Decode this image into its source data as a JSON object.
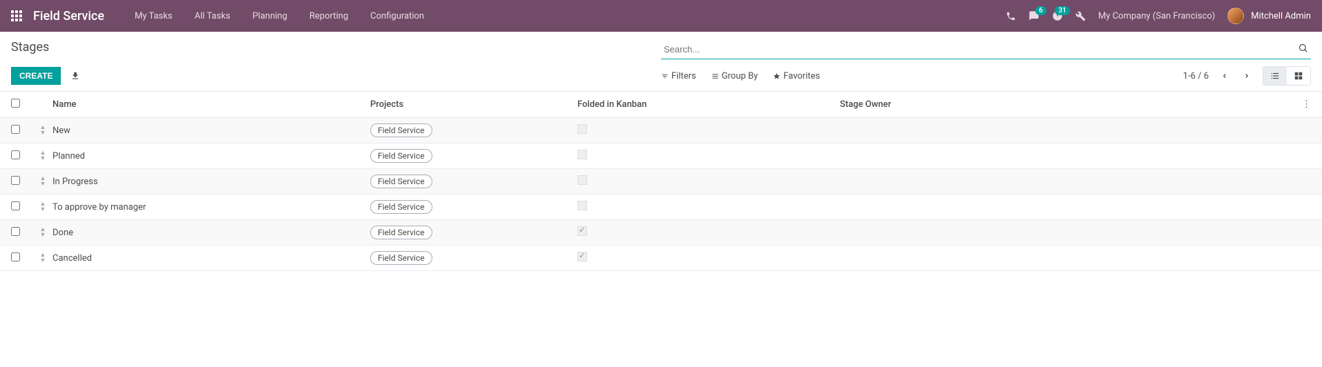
{
  "navbar": {
    "brand": "Field Service",
    "menu": [
      "My Tasks",
      "All Tasks",
      "Planning",
      "Reporting",
      "Configuration"
    ],
    "messages_badge": "6",
    "activities_badge": "31",
    "company": "My Company (San Francisco)",
    "user": "Mitchell Admin"
  },
  "control": {
    "title": "Stages",
    "create_label": "CREATE",
    "search_placeholder": "Search...",
    "filters_label": "Filters",
    "groupby_label": "Group By",
    "favorites_label": "Favorites",
    "pager": "1-6 / 6"
  },
  "table": {
    "headers": {
      "name": "Name",
      "projects": "Projects",
      "folded": "Folded in Kanban",
      "owner": "Stage Owner"
    },
    "rows": [
      {
        "name": "New",
        "project": "Field Service",
        "folded": false,
        "owner": ""
      },
      {
        "name": "Planned",
        "project": "Field Service",
        "folded": false,
        "owner": ""
      },
      {
        "name": "In Progress",
        "project": "Field Service",
        "folded": false,
        "owner": ""
      },
      {
        "name": "To approve by manager",
        "project": "Field Service",
        "folded": false,
        "owner": ""
      },
      {
        "name": "Done",
        "project": "Field Service",
        "folded": true,
        "owner": ""
      },
      {
        "name": "Cancelled",
        "project": "Field Service",
        "folded": true,
        "owner": ""
      }
    ]
  }
}
